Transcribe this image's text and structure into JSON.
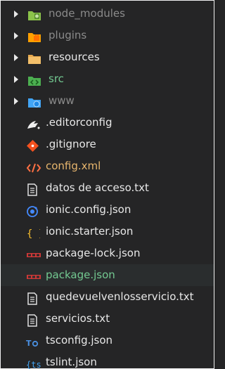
{
  "explorer": {
    "items": [
      {
        "label": "node_modules",
        "icon": "folder-node-icon",
        "kind": "folder",
        "tone": "dim"
      },
      {
        "label": "plugins",
        "icon": "folder-plugins-icon",
        "kind": "folder",
        "tone": "dim"
      },
      {
        "label": "resources",
        "icon": "folder-resources-icon",
        "kind": "folder",
        "tone": "white"
      },
      {
        "label": "src",
        "icon": "folder-src-icon",
        "kind": "folder",
        "tone": "green"
      },
      {
        "label": "www",
        "icon": "folder-www-icon",
        "kind": "folder",
        "tone": "dim"
      },
      {
        "label": ".editorconfig",
        "icon": "editorconfig-icon",
        "kind": "file",
        "tone": "white"
      },
      {
        "label": ".gitignore",
        "icon": "git-icon",
        "kind": "file",
        "tone": "white"
      },
      {
        "label": "config.xml",
        "icon": "xml-icon",
        "kind": "file",
        "tone": "orange"
      },
      {
        "label": "datos de acceso.txt",
        "icon": "text-file-icon",
        "kind": "file",
        "tone": "white"
      },
      {
        "label": "ionic.config.json",
        "icon": "ionic-icon",
        "kind": "file",
        "tone": "white"
      },
      {
        "label": "ionic.starter.json",
        "icon": "json-icon",
        "kind": "file",
        "tone": "white"
      },
      {
        "label": "package-lock.json",
        "icon": "npm-icon",
        "kind": "file",
        "tone": "white"
      },
      {
        "label": "package.json",
        "icon": "npm-icon",
        "kind": "file",
        "tone": "green",
        "selected": true
      },
      {
        "label": "quedevuelvenlosservicio.txt",
        "icon": "text-file-icon",
        "kind": "file",
        "tone": "white"
      },
      {
        "label": "servicios.txt",
        "icon": "text-file-icon",
        "kind": "file",
        "tone": "white"
      },
      {
        "label": "tsconfig.json",
        "icon": "typescript-config-icon",
        "kind": "file",
        "tone": "white"
      },
      {
        "label": "tslint.json",
        "icon": "tslint-icon",
        "kind": "file",
        "tone": "white"
      }
    ]
  }
}
